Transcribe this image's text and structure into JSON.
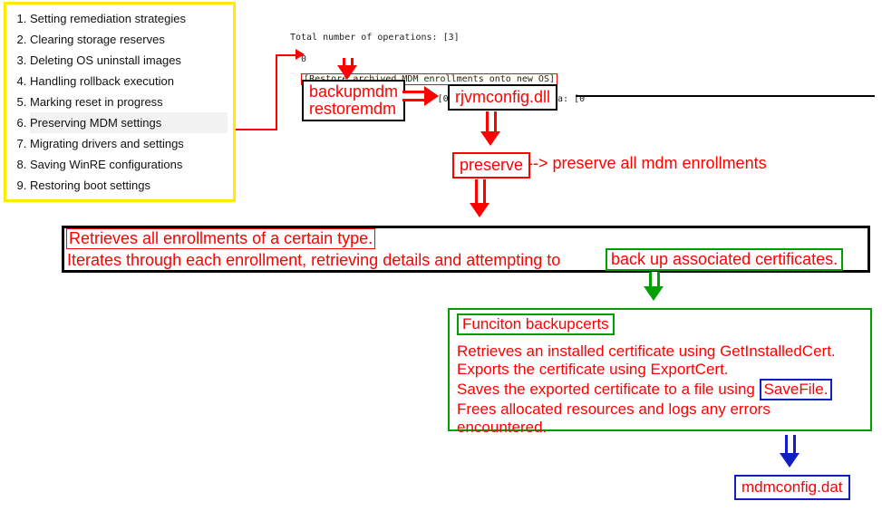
{
  "sidebar": {
    "items": [
      {
        "label": "Setting remediation strategies"
      },
      {
        "label": "Clearing storage reserves"
      },
      {
        "label": "Deleting OS uninstall images"
      },
      {
        "label": "Handling rollback execution"
      },
      {
        "label": "Marking reset in progress"
      },
      {
        "label": "Preserving MDM settings"
      },
      {
        "label": "Migrating drivers and settings"
      },
      {
        "label": "Saving WinRE configurations"
      },
      {
        "label": "Restoring boot settings"
      }
    ],
    "selected_index": 5
  },
  "log": {
    "line1": "Total number of operations: [3]",
    "line2_left": "0",
    "line2_highlight": "[Restore archived MDM enrollments onto new OS]",
    "line2_right": "(RestoreMDM): Peak disk: [0 byte(s)], Disk delta: [0"
  },
  "boxes": {
    "backup_restore_l1": "backupmdm",
    "backup_restore_l2": "restoremdm",
    "rjvmconfig": "rjvmconfig.dll",
    "preserve": "preserve",
    "preserve_all_note": "--> preserve all mdm enrollments",
    "retrieve_line1": "Retrieves all enrollments of a certain type.",
    "retrieve_line2a": "Iterates through each enrollment, retrieving details and attempting to",
    "retrieve_line2b": "back up associated certificates.",
    "func_title": "Funciton backupcerts",
    "func_body_l1": "Retrieves an installed certificate using GetInstalledCert.",
    "func_body_l2": "Exports the certificate using ExportCert.",
    "func_body_l3a": "Saves the exported certificate to a file using",
    "func_body_l3b": "SaveFile.",
    "func_body_l4": "Frees allocated resources and logs any errors encountered.",
    "mdmconfig": "mdmconfig.dat"
  }
}
